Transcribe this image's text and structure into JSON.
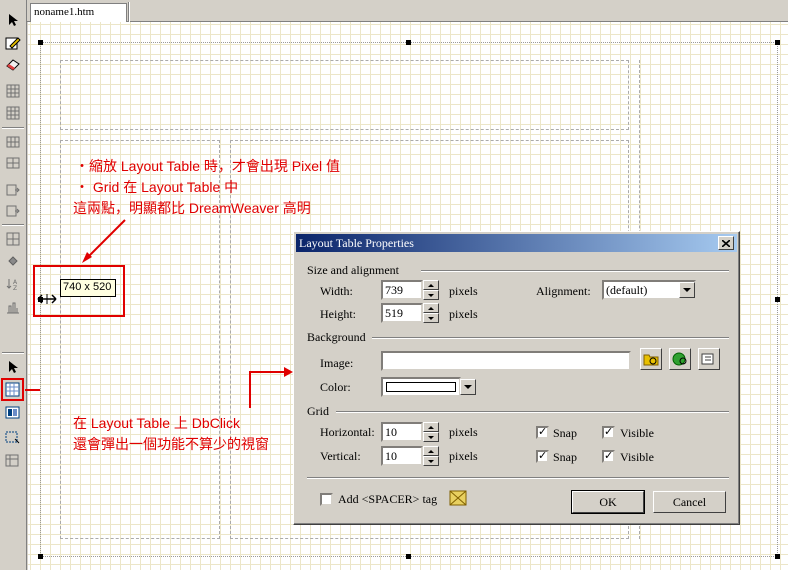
{
  "document_tab": {
    "label": "noname1.htm"
  },
  "size_tooltip": "740 x 520",
  "annotations": {
    "top_line1": "・縮放 Layout Table 時，才會出現 Pixel 值",
    "top_line2": "・ Grid 在 Layout Table 中",
    "top_line3": "這兩點，明顯都比 DreamWeaver 高明",
    "bottom_line1": "在 Layout Table 上 DbClick",
    "bottom_line2": "還會彈出一個功能不算少的視窗"
  },
  "toolbar": {
    "icons": [
      "select-arrow-icon",
      "edit-icon",
      "eraser-icon",
      "table-icon",
      "table-alt-icon",
      "insert-rows-icon",
      "insert-cols-icon",
      "merge-cells-icon",
      "split-cells-icon",
      "layer-icon",
      "fill-icon",
      "sort-icon",
      "chart-icon",
      "pointer-icon",
      "layout-table-icon",
      "layout-cell-icon",
      "draw-cell-icon",
      "delete-cell-icon"
    ],
    "accent": "#e00000"
  },
  "dialog": {
    "title": "Layout Table Properties",
    "size_group": "Size and alignment",
    "width_label": "Width:",
    "width_value": "739",
    "width_unit": "pixels",
    "height_label": "Height:",
    "height_value": "519",
    "height_unit": "pixels",
    "alignment_label": "Alignment:",
    "alignment_value": "(default)",
    "background_group": "Background",
    "image_label": "Image:",
    "image_value": "",
    "color_label": "Color:",
    "color_value": "#ffffff",
    "grid_group": "Grid",
    "horizontal_label": "Horizontal:",
    "horizontal_value": "10",
    "horizontal_unit": "pixels",
    "vertical_label": "Vertical:",
    "vertical_value": "10",
    "vertical_unit": "pixels",
    "snap_label": "Snap",
    "visible_label": "Visible",
    "h_snap": true,
    "h_visible": true,
    "v_snap": true,
    "v_visible": true,
    "spacer_label": "Add <SPACER> tag",
    "spacer_checked": false,
    "ok_label": "OK",
    "cancel_label": "Cancel",
    "title_color": "#0a246a"
  }
}
